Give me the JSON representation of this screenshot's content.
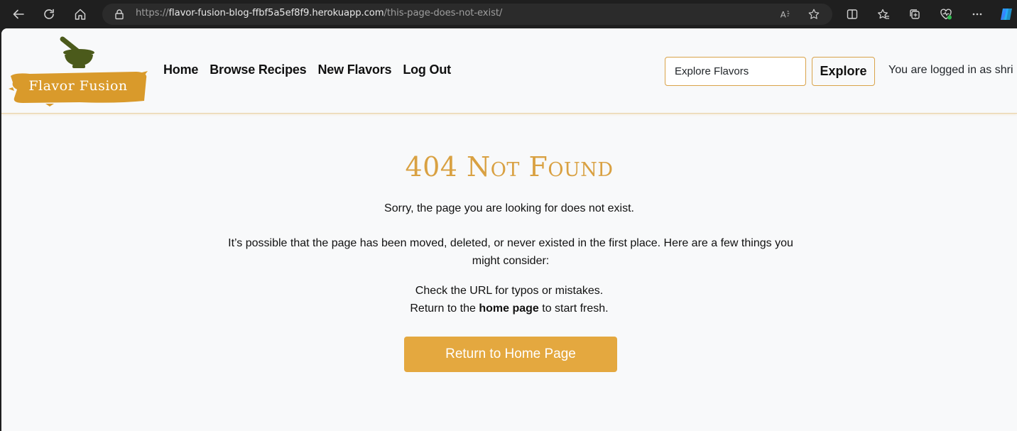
{
  "browser": {
    "url_scheme": "https://",
    "url_host": "flavor-fusion-blog-ffbf5a5ef8f9.herokuapp.com",
    "url_path": "/this-page-does-not-exist/",
    "icons": [
      "back-icon",
      "refresh-icon",
      "home-icon",
      "lock-icon",
      "read-aloud-icon",
      "favorite-star-icon",
      "split-screen-icon",
      "favorites-icon",
      "collections-icon",
      "browser-essentials-icon",
      "more-icon",
      "copilot-icon"
    ]
  },
  "navbar": {
    "brand": "Flavor Fusion",
    "links": [
      "Home",
      "Browse Recipes",
      "New Flavors",
      "Log Out"
    ],
    "search_placeholder": "Explore Flavors",
    "explore_label": "Explore",
    "login_status": "You are logged in as shri"
  },
  "main": {
    "title": "404 Not Found",
    "message": "Sorry, the page you are looking for does not exist.",
    "explanation": "It’s possible that the page has been moved, deleted, or never existed in the first place. Here are a few things you might consider:",
    "tip_check_url": "Check the URL for typos or mistakes.",
    "tip_return_prefix": "Return to the",
    "tip_return_link": "home page",
    "tip_return_suffix": "to start fresh.",
    "button_label": "Return to Home Page"
  },
  "colors": {
    "accent": "#e4a83f",
    "title": "#d9a142",
    "logo_green": "#4b5a1b",
    "page_bg": "#f8f9fa",
    "chrome_bg": "#1f1f1f"
  }
}
